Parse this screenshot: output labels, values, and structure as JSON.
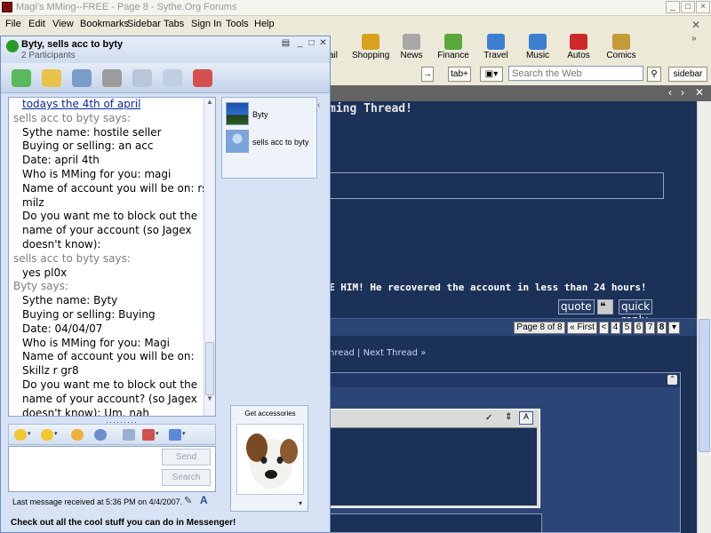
{
  "browser": {
    "title": "Magi's MMing--FREE - Page 8 - Sythe.Org Forums",
    "menu": [
      "File",
      "Edit",
      "View",
      "Bookmarks",
      "Sidebar",
      "Tabs",
      "Sign In",
      "Tools",
      "Help"
    ],
    "toolbar": [
      {
        "label": "ail",
        "icon": "mail-icon",
        "color": "#5a7fbf"
      },
      {
        "label": "Shopping",
        "icon": "shopping-bag-icon",
        "color": "#d9a21e"
      },
      {
        "label": "News",
        "icon": "newspaper-icon",
        "color": "#9a9a9a"
      },
      {
        "label": "Finance",
        "icon": "finance-chart-icon",
        "color": "#5aa83a"
      },
      {
        "label": "Travel",
        "icon": "suitcase-icon",
        "color": "#3f7fcf"
      },
      {
        "label": "Music",
        "icon": "music-icon",
        "color": "#3c7fd0"
      },
      {
        "label": "Autos",
        "icon": "car-icon",
        "color": "#cc2a2a"
      },
      {
        "label": "Comics",
        "icon": "comics-icon",
        "color": "#c49a3a"
      }
    ],
    "address": {
      "go_label": "→",
      "tab_label": "tab+",
      "search_placeholder": "Search the Web",
      "sidebar_label": "sidebar"
    }
  },
  "forum": {
    "thread_title_fragment": "ming Thread!",
    "post_text": "E HIM! He recovered the account in less than 24 hours!",
    "quote_label": "quote",
    "quick_reply_label": "quick reply",
    "pagination": {
      "label": "Page 8 of 8",
      "first_label": "« First",
      "prev_label": "<",
      "pages": [
        "4",
        "5",
        "6",
        "7",
        "8"
      ],
      "current": "8"
    },
    "nav_links": "hread | Next Thread »"
  },
  "messenger": {
    "title": "Byty, sells acc to byty",
    "participants_count": "2 Participants",
    "participants": [
      {
        "name": "Byty",
        "avatar": "tree-sky-picture"
      },
      {
        "name": "sells acc to byty",
        "avatar": "default-person-picture"
      }
    ],
    "conversation": [
      {
        "type": "link",
        "text": "todays the 4th of april"
      },
      {
        "type": "sender",
        "text": "sells acc to byty says:"
      },
      {
        "type": "msg",
        "text": "Sythe name: hostile seller"
      },
      {
        "type": "msg",
        "text": "Buying or selling: an acc"
      },
      {
        "type": "msg",
        "text": "Date: april 4th"
      },
      {
        "type": "msg",
        "text": "Who is MMing for you: magi"
      },
      {
        "type": "msg",
        "text": "Name of account you will be on: rs"
      },
      {
        "type": "msg",
        "text": "milz"
      },
      {
        "type": "msg",
        "text": "Do you want me to block out the"
      },
      {
        "type": "msg",
        "text": "name of your account      (so Jagex"
      },
      {
        "type": "msg",
        "text": "doesn't know):"
      },
      {
        "type": "sender",
        "text": "sells acc to byty says:"
      },
      {
        "type": "msg",
        "text": "yes pl0x"
      },
      {
        "type": "sender",
        "text": "Byty says:"
      },
      {
        "type": "msg",
        "text": "Sythe name: Byty"
      },
      {
        "type": "msg",
        "text": "Buying or selling: Buying"
      },
      {
        "type": "msg",
        "text": "Date: 04/04/07"
      },
      {
        "type": "msg",
        "text": "Who is MMing for you: Magi"
      },
      {
        "type": "msg",
        "text": "Name of account you will be on:"
      },
      {
        "type": "msg",
        "text": "Skillz r gr8"
      },
      {
        "type": "msg",
        "text": "Do you want me to block out the"
      },
      {
        "type": "msg",
        "text": "name of your account? (so Jagex"
      },
      {
        "type": "msg",
        "text": "doesn't know): Um, nah"
      }
    ],
    "accessories_label": "Get accessories",
    "send_label": "Send",
    "search_label": "Search",
    "status": "Last message received at 5:36 PM on 4/4/2007.",
    "footer": "Check out all the cool stuff you can do in Messenger!"
  }
}
